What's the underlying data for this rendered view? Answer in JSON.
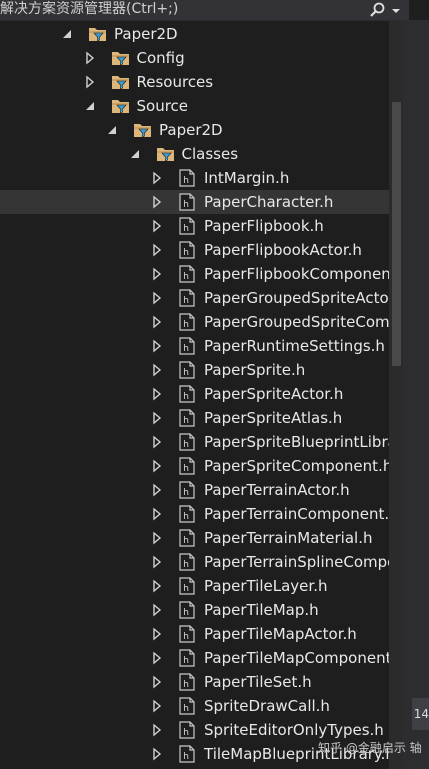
{
  "search": {
    "placeholder": "解决方案资源管理器(Ctrl+;)"
  },
  "tree": {
    "root": {
      "label": "Paper2D"
    },
    "folders": {
      "config": "Config",
      "resources": "Resources",
      "source": "Source",
      "source_paper2d": "Paper2D",
      "classes": "Classes"
    },
    "files": [
      "IntMargin.h",
      "PaperCharacter.h",
      "PaperFlipbook.h",
      "PaperFlipbookActor.h",
      "PaperFlipbookComponent.h",
      "PaperGroupedSpriteActor.h",
      "PaperGroupedSpriteComponent.h",
      "PaperRuntimeSettings.h",
      "PaperSprite.h",
      "PaperSpriteActor.h",
      "PaperSpriteAtlas.h",
      "PaperSpriteBlueprintLibrary.h",
      "PaperSpriteComponent.h",
      "PaperTerrainActor.h",
      "PaperTerrainComponent.h",
      "PaperTerrainMaterial.h",
      "PaperTerrainSplineComponent.h",
      "PaperTileLayer.h",
      "PaperTileMap.h",
      "PaperTileMapActor.h",
      "PaperTileMapComponent.h",
      "PaperTileSet.h",
      "SpriteDrawCall.h",
      "SpriteEditorOnlyTypes.h",
      "TileMapBlueprintLibrary.h"
    ],
    "selected_file": "PaperCharacter.h"
  },
  "side": {
    "box_text": "14"
  },
  "watermark": {
    "text": "知乎 @金融启示 轴"
  },
  "colors": {
    "background": "#1e1e1e",
    "selected": "#353535",
    "folder": "#dcb67a",
    "filter": "#3c9bd6"
  }
}
